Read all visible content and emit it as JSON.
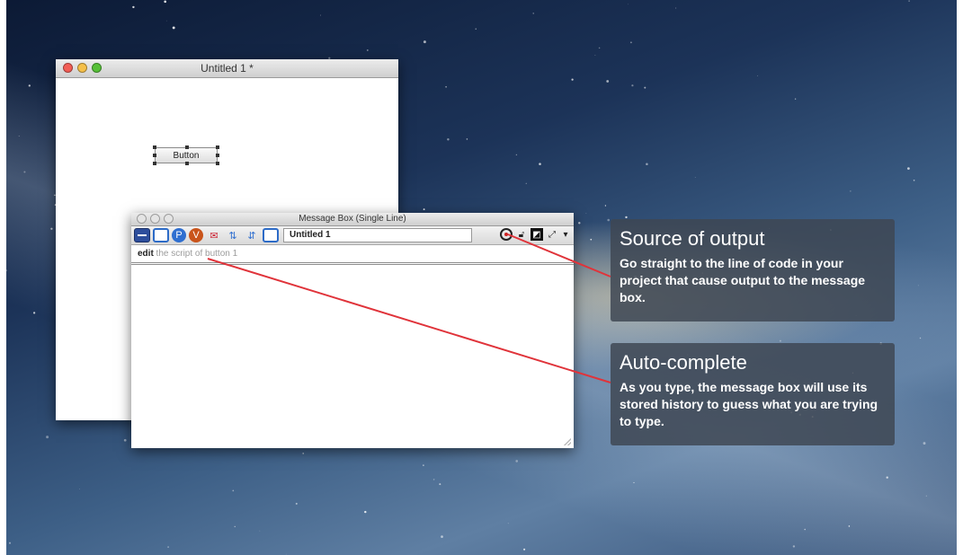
{
  "untitled_window": {
    "title": "Untitled 1 *",
    "button_label": "Button"
  },
  "message_box": {
    "title": "Message Box (Single Line)",
    "stack_field": "Untitled 1",
    "command_typed": "edit",
    "command_suggestion": " the script of button 1",
    "toolbar_icons": [
      "single-line-icon",
      "multi-line-icon",
      "global-properties-icon",
      "global-variables-icon",
      "pending-messages-icon",
      "front-scripts-icon",
      "back-scripts-icon",
      "stack-icon"
    ],
    "right_icons": [
      "source-of-output-icon",
      "lock-icon",
      "clear-icon",
      "resize-icon",
      "dropdown-arrow-icon"
    ]
  },
  "callouts": {
    "source": {
      "title": "Source of output",
      "body": "Go straight to the line of code in your project that cause output to the message box."
    },
    "auto": {
      "title": "Auto-complete",
      "body": "As you type, the message box will use its stored history to guess what you are trying to type."
    }
  },
  "colors": {
    "pointer_line": "#e0333a",
    "callout_bg": "#3e4652"
  }
}
